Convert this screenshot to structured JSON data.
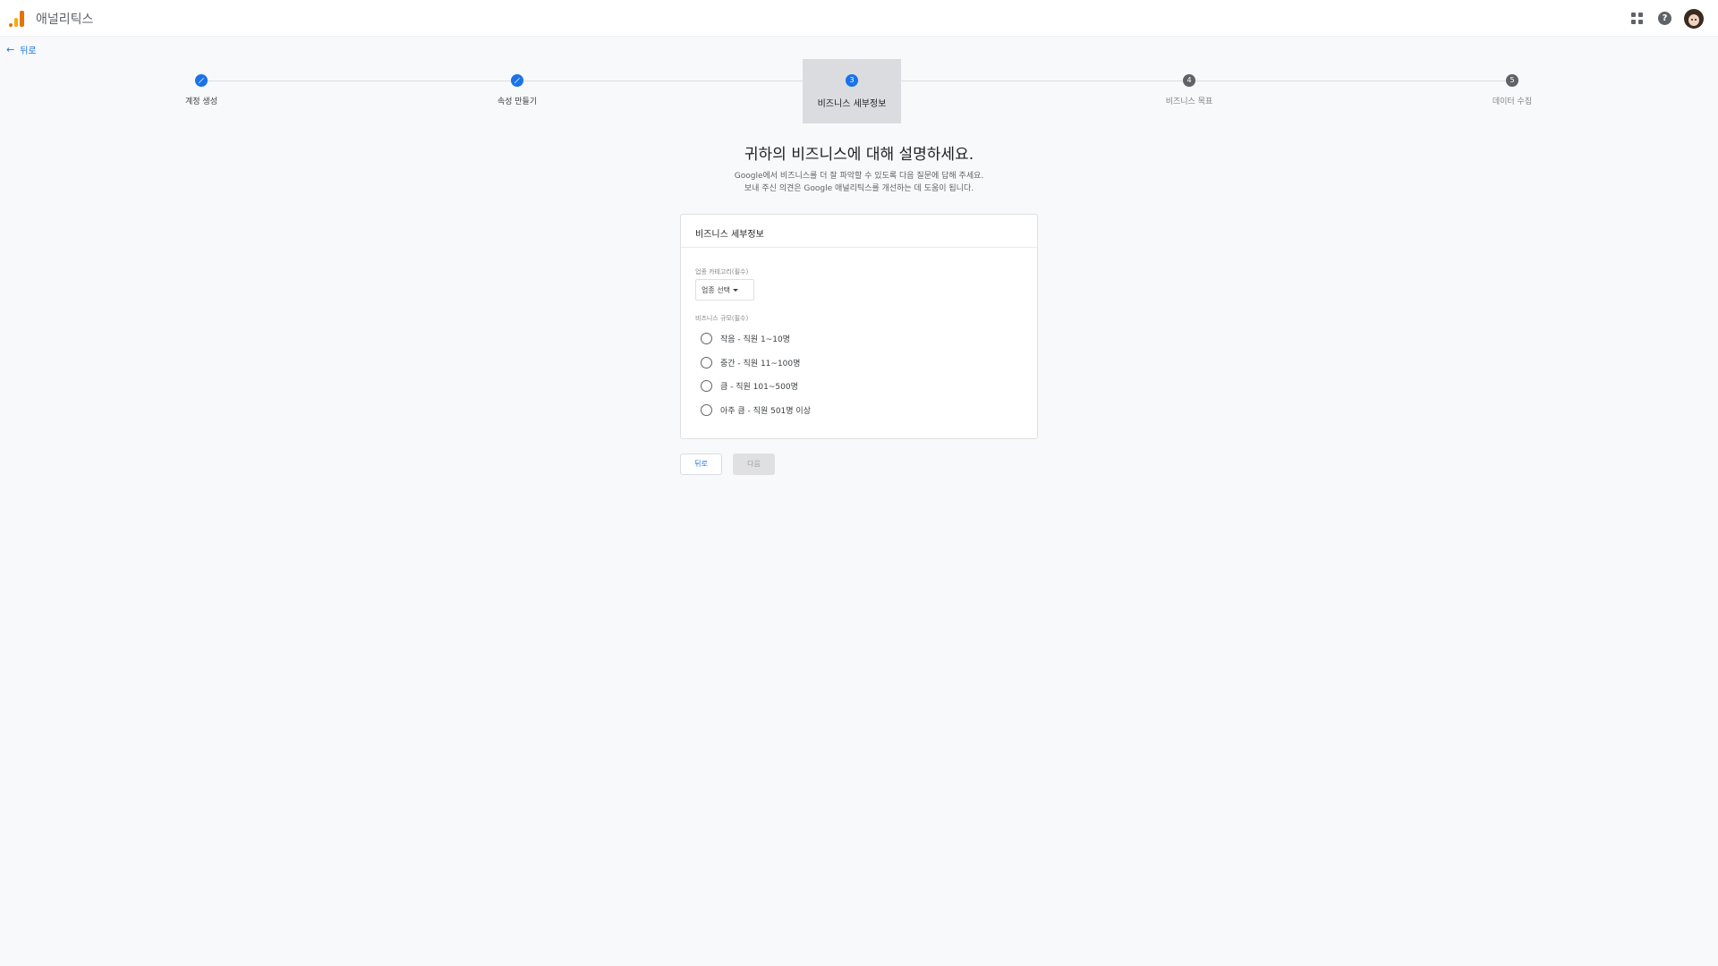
{
  "app": {
    "title": "애널리틱스"
  },
  "nav": {
    "back_label": "뒤로"
  },
  "stepper": {
    "steps": [
      {
        "number": "1",
        "label": "계정 생성",
        "state": "done"
      },
      {
        "number": "2",
        "label": "속성 만들기",
        "state": "done"
      },
      {
        "number": "3",
        "label": "비즈니스 세부정보",
        "state": "current"
      },
      {
        "number": "4",
        "label": "비즈니스 목표",
        "state": "todo"
      },
      {
        "number": "5",
        "label": "데이터 수집",
        "state": "todo"
      }
    ]
  },
  "main": {
    "heading": "귀하의 비즈니스에 대해 설명하세요.",
    "description_line1": "Google에서 비즈니스를 더 잘 파악할 수 있도록 다음 질문에 답해 주세요.",
    "description_line2": "보내 주신 의견은 Google 애널리틱스를 개선하는 데 도움이 됩니다."
  },
  "card": {
    "title": "비즈니스 세부정보",
    "industry_label": "업종 카테고리(필수)",
    "industry_select": "업종 선택",
    "size_label": "비즈니스 규모(필수)",
    "size_options": [
      "작음 - 직원 1~10명",
      "중간 - 직원 11~100명",
      "큼 - 직원 101~500명",
      "아주 큼 - 직원 501명 이상"
    ]
  },
  "footer": {
    "back_button": "뒤로",
    "next_button": "다음"
  },
  "colors": {
    "accent": "#1a73e8",
    "background": "#f8f9fa",
    "logo_orange": "#e37400",
    "logo_yellow": "#f9ab00"
  },
  "icons": {
    "logo": "analytics-logo-icon",
    "apps": "apps-grid-icon",
    "help": "help-icon",
    "back": "arrow-back-icon",
    "edit": "pencil-icon"
  }
}
